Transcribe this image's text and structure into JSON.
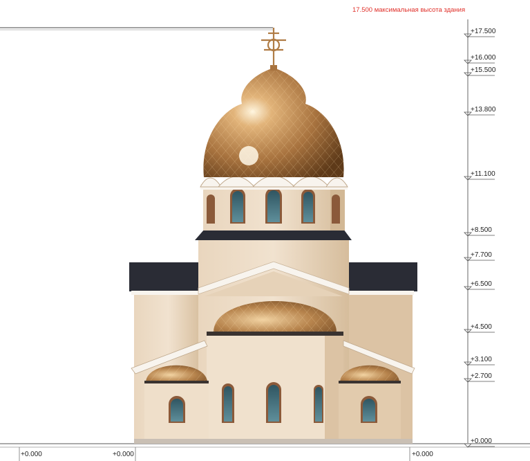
{
  "max_height_note": "17.500 максимальная высота здания",
  "elevations": [
    {
      "label": "+17.500",
      "value": 17.5
    },
    {
      "label": "+16.000",
      "value": 16.0
    },
    {
      "label": "+15.500",
      "value": 15.5
    },
    {
      "label": "+13.800",
      "value": 13.8
    },
    {
      "label": "+11.100",
      "value": 11.1
    },
    {
      "label": "+8.500",
      "value": 8.5
    },
    {
      "label": "+7.700",
      "value": 7.7
    },
    {
      "label": "+6.500",
      "value": 6.5
    },
    {
      "label": "+4.500",
      "value": 4.5
    },
    {
      "label": "+3.100",
      "value": 3.1
    },
    {
      "label": "+2.700",
      "value": 2.7
    },
    {
      "label": "+0.000",
      "value": 0.0
    }
  ],
  "ground_labels": [
    "+0.000",
    "+0.000",
    "+0.000"
  ],
  "colors": {
    "wall": "#eeddc8",
    "wall_shadow": "#dcc3a4",
    "trim": "#f8f4ee",
    "roof": "#2a2c35",
    "gold": "#c9975e",
    "gold_dark": "#7a5026",
    "window_glass": "#3f6a78",
    "annotation": "#e0302a"
  }
}
